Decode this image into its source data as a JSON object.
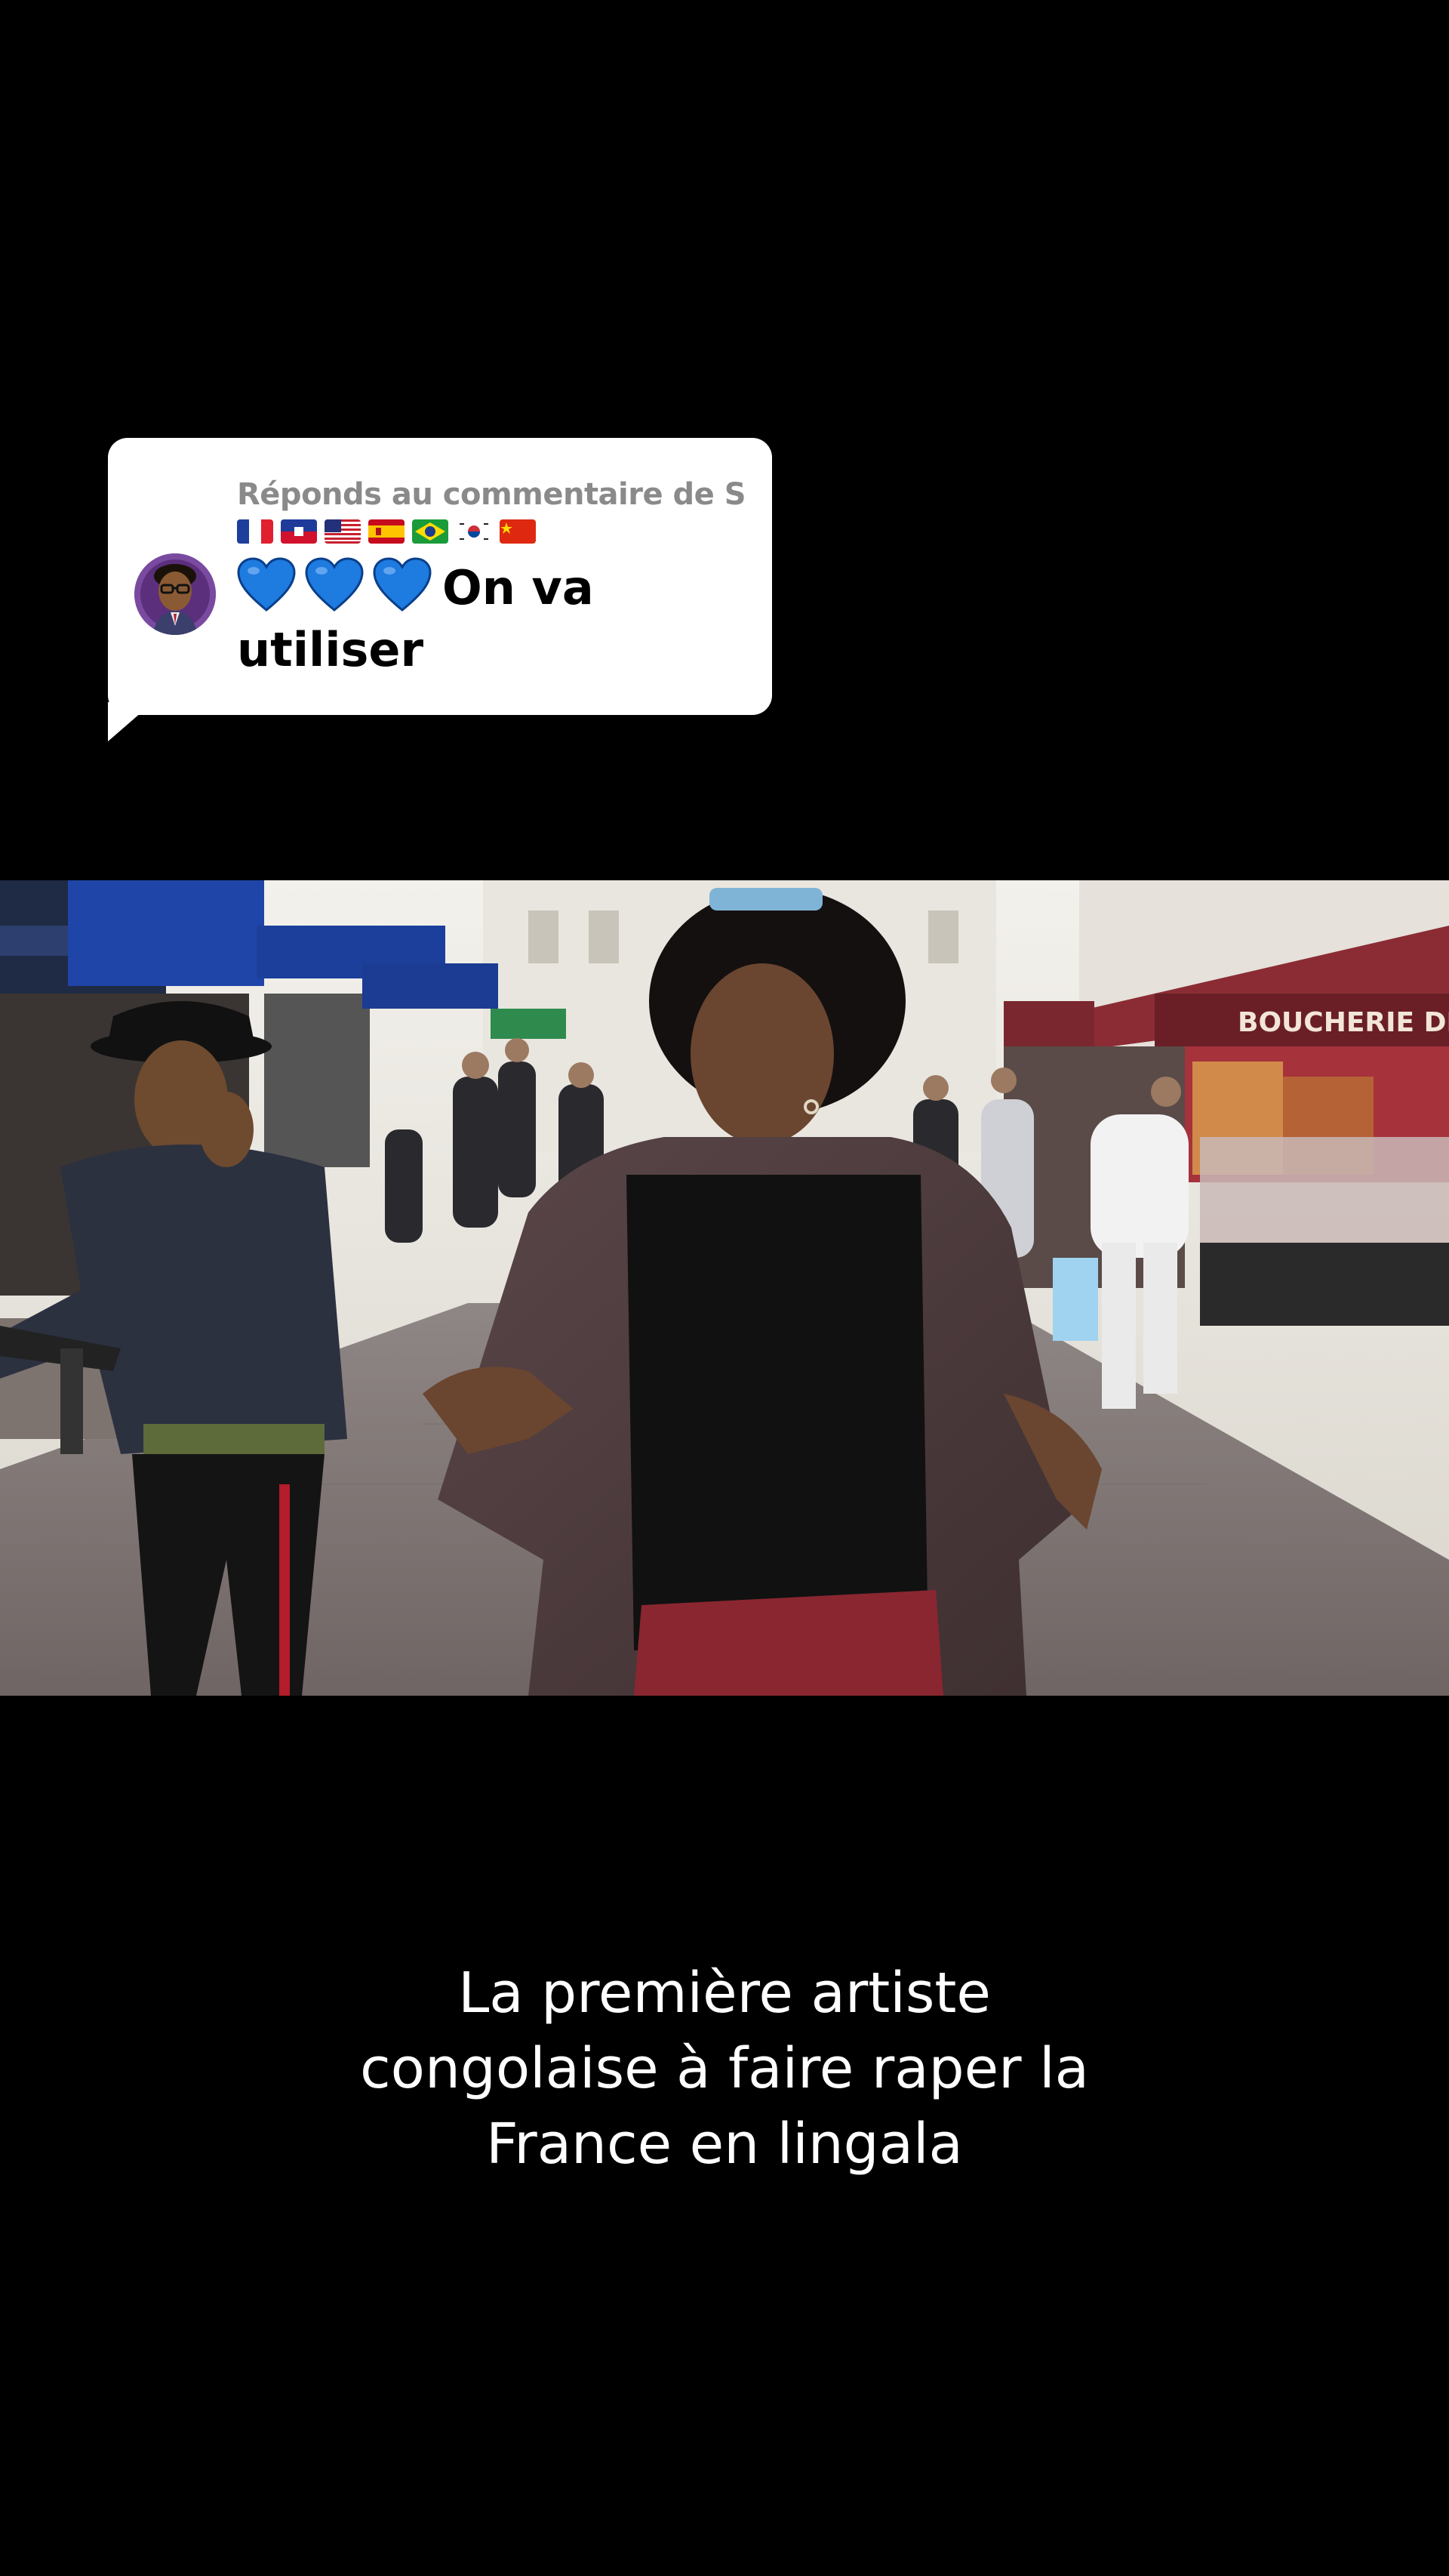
{
  "reply": {
    "header": "Réponds au commentaire de S",
    "flags": [
      "flag-france-icon",
      "flag-haiti-icon",
      "flag-usa-icon",
      "flag-spain-icon",
      "flag-brazil-icon",
      "flag-south-korea-icon",
      "flag-china-icon"
    ],
    "hearts": [
      "blue-heart-icon",
      "blue-heart-icon",
      "blue-heart-icon"
    ],
    "text": "On va utiliser"
  },
  "video": {
    "storefront_sign": "BOUCHERIE DEJEAN"
  },
  "caption": {
    "lines": [
      "La première artiste",
      "congolaise à faire raper la",
      "France en lingala"
    ]
  },
  "colors": {
    "background": "#000000",
    "card": "#ffffff",
    "heart": "#1e7be0"
  }
}
